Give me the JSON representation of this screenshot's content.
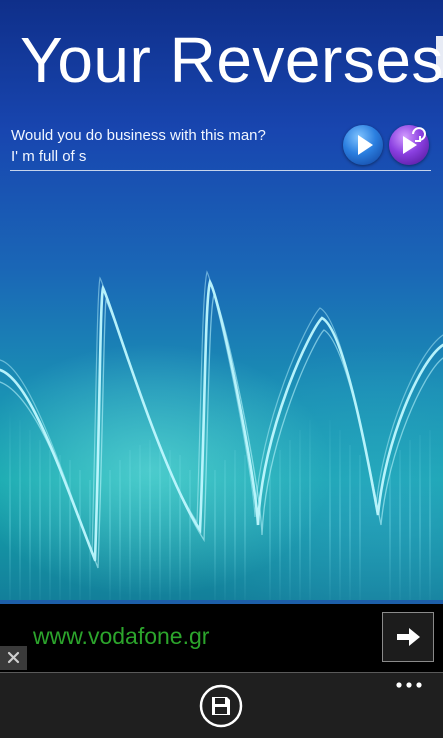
{
  "header": {
    "title": "Your Reverses"
  },
  "reverses": [
    {
      "title": "Would you do business with this man?",
      "reversed_text": "I' m full of s",
      "play_icon": "play-icon",
      "play_reverse_icon": "play-reverse-icon"
    }
  ],
  "ad": {
    "text": "www.vodafone.gr",
    "arrow_icon": "arrow-right-icon",
    "close_icon": "close-icon",
    "text_color": "#2ca52c"
  },
  "app_bar": {
    "save_icon": "save-icon",
    "more_icon": "more-dots-icon"
  },
  "colors": {
    "background_top": "#0f2f8a",
    "background_bottom": "#137f9a",
    "play_button": "#2b7fe0",
    "play_reverse_button": "#8a3fe0",
    "app_bar": "#1f1f1f"
  }
}
